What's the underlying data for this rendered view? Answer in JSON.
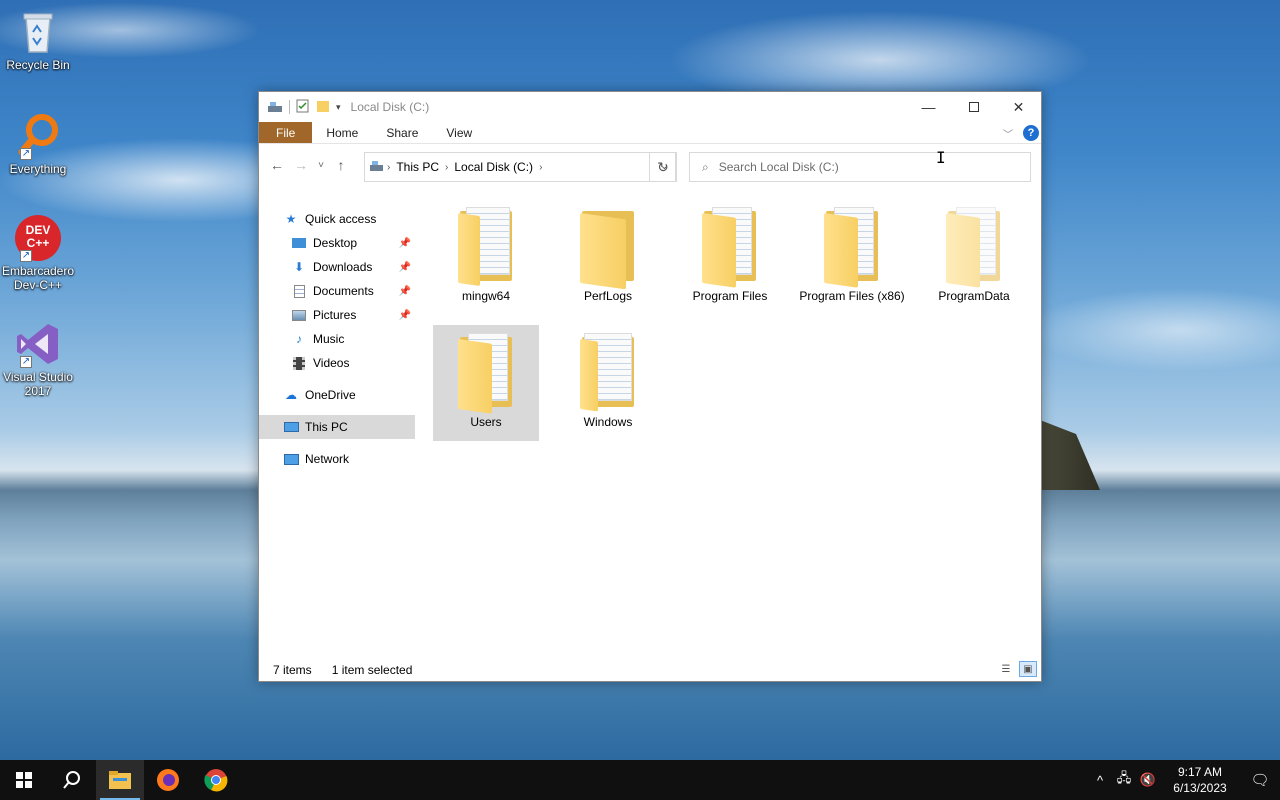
{
  "desktop": {
    "icons": [
      {
        "label": "Recycle Bin",
        "icon": "recycle-bin-icon"
      },
      {
        "label": "Everything",
        "icon": "everything-search-icon"
      },
      {
        "label": "Embarcadero Dev-C++",
        "icon": "devcpp-icon",
        "badge": "DEV C++"
      },
      {
        "label": "Visual Studio 2017",
        "icon": "visual-studio-icon"
      }
    ]
  },
  "window": {
    "title": "Local Disk (C:)",
    "ribbon_tabs": [
      "File",
      "Home",
      "Share",
      "View"
    ],
    "help_label": "?",
    "address": {
      "segments": [
        "This PC",
        "Local Disk (C:)"
      ]
    },
    "search": {
      "placeholder": "Search Local Disk (C:)"
    },
    "nav_pane": {
      "quick_access": "Quick access",
      "pinned": [
        "Desktop",
        "Downloads",
        "Documents",
        "Pictures"
      ],
      "unpinned": [
        "Music",
        "Videos"
      ],
      "onedrive": "OneDrive",
      "this_pc": "This PC",
      "network": "Network"
    },
    "items": [
      {
        "name": "mingw64",
        "type": "folder-docs"
      },
      {
        "name": "PerfLogs",
        "type": "folder-empty"
      },
      {
        "name": "Program Files",
        "type": "folder-files"
      },
      {
        "name": "Program Files (x86)",
        "type": "folder-files"
      },
      {
        "name": "ProgramData",
        "type": "folder-files-light"
      },
      {
        "name": "Users",
        "type": "folder-files",
        "selected": true
      },
      {
        "name": "Windows",
        "type": "folder-docs"
      }
    ],
    "status": {
      "count": "7 items",
      "selection": "1 item selected"
    }
  },
  "taskbar": {
    "time": "9:17 AM",
    "date": "6/13/2023",
    "pinned": [
      "start",
      "search",
      "file-explorer",
      "firefox",
      "chrome"
    ]
  },
  "colors": {
    "file_tab": "#a0662a",
    "selection": "#d9d9d9",
    "folder": "#f7cf63",
    "taskbar": "#101010"
  }
}
